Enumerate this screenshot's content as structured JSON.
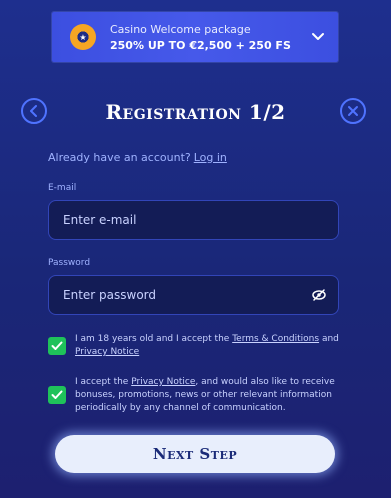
{
  "banner": {
    "title": "Casino Welcome package",
    "offer": "250% UP TO €2,500 + 250 FS"
  },
  "header": {
    "title": "Registration 1/2"
  },
  "account_prompt": {
    "text": "Already have an account?",
    "login_link": "Log in"
  },
  "email": {
    "label": "E-mail",
    "placeholder": "Enter e-mail"
  },
  "password": {
    "label": "Password",
    "placeholder": "Enter password"
  },
  "consent_age": {
    "checked": true,
    "text_before": "I am 18 years old and I accept the",
    "terms_link": "Terms & Conditions",
    "text_and": "and",
    "privacy_link": "Privacy Notice"
  },
  "consent_marketing": {
    "checked": true,
    "text_before": "I accept the",
    "privacy_link": "Privacy Notice",
    "text_after": ", and would also like to receive bonuses, promotions, news or other relevant information periodically by any channel of communication."
  },
  "next_button": {
    "label": "Next Step"
  },
  "colors": {
    "background": "#1e2f8e",
    "banner": "#4659ea",
    "accent": "#4f73ff",
    "checkbox": "#1fc25a",
    "button": "#e8eefc"
  },
  "icons": {
    "banner": "casino-chip-icon",
    "banner_toggle": "chevron-down-icon",
    "back": "chevron-left-icon",
    "close": "close-icon",
    "password_toggle": "eye-off-icon",
    "checkbox": "check-icon"
  }
}
